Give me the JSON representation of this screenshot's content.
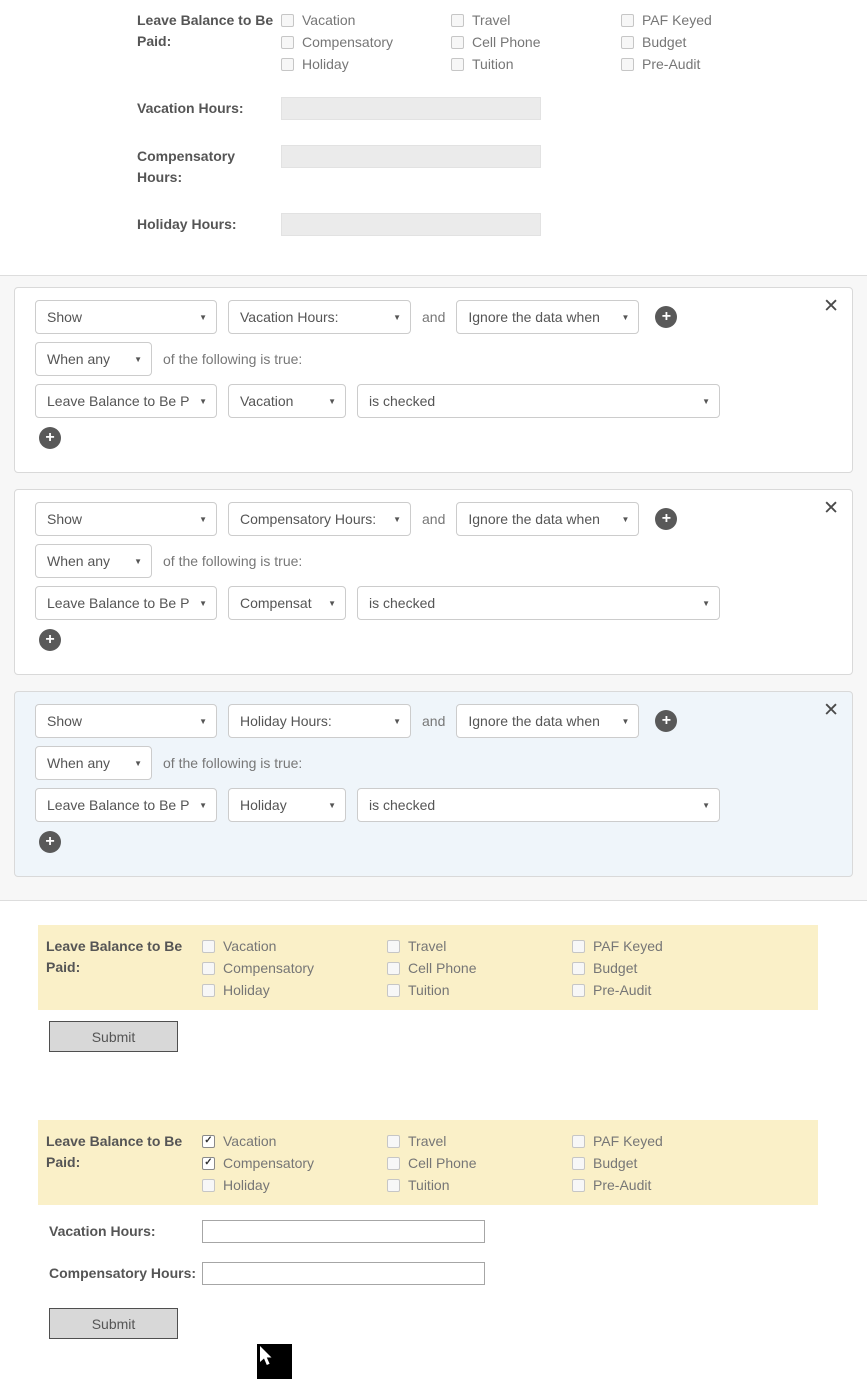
{
  "icons": {
    "dropdown_arrow": "▼",
    "plus": "+",
    "close": "✕",
    "check": "✓"
  },
  "colors": {
    "highlight_yellow": "#faf0c8",
    "active_panel_blue": "#eff5fa",
    "plus_button_gray": "#595959"
  },
  "top_form": {
    "group_label": "Leave Balance to Be Paid:",
    "columns": [
      [
        "Vacation",
        "Compensatory",
        "Holiday"
      ],
      [
        "Travel",
        "Cell Phone",
        "Tuition"
      ],
      [
        "PAF Keyed",
        "Budget",
        "Pre-Audit"
      ]
    ],
    "fields": [
      {
        "label": "Vacation Hours:",
        "value": ""
      },
      {
        "label": "Compensatory Hours:",
        "value": ""
      },
      {
        "label": "Holiday Hours:",
        "value": ""
      }
    ]
  },
  "rules": [
    {
      "action": "Show",
      "field": "Vacation Hours:",
      "conjunction": "and",
      "data_option": "Ignore the data when",
      "match": "When any",
      "match_text": "of the following is true:",
      "condition": {
        "field": "Leave Balance to Be P",
        "value": "Vacation",
        "operator": "is checked"
      }
    },
    {
      "action": "Show",
      "field": "Compensatory Hours:",
      "conjunction": "and",
      "data_option": "Ignore the data when",
      "match": "When any",
      "match_text": "of the following is true:",
      "condition": {
        "field": "Leave Balance to Be P",
        "value": "Compensat",
        "operator": "is checked"
      }
    },
    {
      "action": "Show",
      "field": "Holiday Hours:",
      "conjunction": "and",
      "data_option": "Ignore the data when",
      "match": "When any",
      "match_text": "of the following is true:",
      "condition": {
        "field": "Leave Balance to Be P",
        "value": "Holiday",
        "operator": "is checked"
      }
    }
  ],
  "preview_default": {
    "group_label": "Leave Balance to Be Paid:",
    "columns": [
      [
        "Vacation",
        "Compensatory",
        "Holiday"
      ],
      [
        "Travel",
        "Cell Phone",
        "Tuition"
      ],
      [
        "PAF Keyed",
        "Budget",
        "Pre-Audit"
      ]
    ],
    "checked": [],
    "submit_label": "Submit"
  },
  "preview_active": {
    "group_label": "Leave Balance to Be Paid:",
    "columns": [
      [
        "Vacation",
        "Compensatory",
        "Holiday"
      ],
      [
        "Travel",
        "Cell Phone",
        "Tuition"
      ],
      [
        "PAF Keyed",
        "Budget",
        "Pre-Audit"
      ]
    ],
    "checked": [
      "Vacation",
      "Compensatory"
    ],
    "fields": [
      {
        "label": "Vacation Hours:",
        "value": ""
      },
      {
        "label": "Compensatory Hours:",
        "value": ""
      }
    ],
    "submit_label": "Submit"
  }
}
